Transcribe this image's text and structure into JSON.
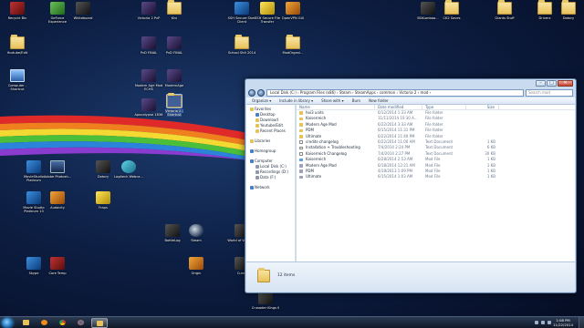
{
  "colors": {
    "selection": "#3399ff",
    "window_frame": "#c9dbef",
    "folder": "#e7c25a"
  },
  "desktop": {
    "icons": [
      {
        "id": "d1",
        "label": "Recycle Bin",
        "icon": "recycle-bin-icon"
      },
      {
        "id": "d2",
        "label": "GeForce Experience",
        "icon": "nvidia-icon"
      },
      {
        "id": "d3",
        "label": "Whiteboard",
        "icon": "app-icon"
      },
      {
        "id": "d4",
        "label": "Victoria 2 PvP",
        "icon": "victoria-2-icon"
      },
      {
        "id": "d5",
        "label": "Kivi",
        "icon": "folder-icon"
      },
      {
        "id": "d6",
        "label": "SSH Secure Shell Client",
        "icon": "ssh-icon"
      },
      {
        "id": "d7",
        "label": "SSH Secure File Transfer",
        "icon": "ssh-icon"
      },
      {
        "id": "d8",
        "label": "OpenVPN GUI",
        "icon": "openvpn-icon"
      },
      {
        "id": "d9",
        "label": "BGKumbaa...",
        "icon": "shortcut-icon"
      },
      {
        "id": "d10",
        "label": "CK2 Saves",
        "icon": "folder-icon"
      },
      {
        "id": "d11",
        "label": "Giants Stuff",
        "icon": "folder-icon"
      },
      {
        "id": "d12",
        "label": "Drivers",
        "icon": "folder-icon"
      },
      {
        "id": "d13",
        "label": "Dotory",
        "icon": "folder-icon"
      },
      {
        "id": "d14",
        "label": "Youtube/Edit",
        "icon": "folder-icon"
      },
      {
        "id": "d15",
        "label": "PvD FINAL",
        "icon": "victoria-2-icon"
      },
      {
        "id": "d16",
        "label": "PvD FINAL",
        "icon": "victoria-2-icon"
      },
      {
        "id": "d17",
        "label": "School Shit 2014",
        "icon": "folder-icon"
      },
      {
        "id": "d18",
        "label": "ModOrgani...",
        "icon": "folder-icon"
      },
      {
        "id": "d19",
        "label": "Computer - Shortcut",
        "icon": "computer-icon"
      },
      {
        "id": "d20",
        "label": "Modern Age Mod ECHS",
        "icon": "victoria-2-icon"
      },
      {
        "id": "d21",
        "label": "ModernAge",
        "icon": "victoria-2-icon"
      },
      {
        "id": "d22",
        "label": "Apocalypse 1836",
        "icon": "victoria-2-icon"
      },
      {
        "id": "d23",
        "label": "Victoria 2 - Shortcut",
        "icon": "folder-icon"
      },
      {
        "id": "d24",
        "label": "MovieStudio Platinum",
        "icon": "movie-studio-icon"
      },
      {
        "id": "d25",
        "label": "Adobe Photosh...",
        "icon": "photoshop-icon"
      },
      {
        "id": "d26",
        "label": "Dotory",
        "icon": "app-icon"
      },
      {
        "id": "d27",
        "label": "Logitech Webca...",
        "icon": "webcam-icon"
      },
      {
        "id": "d28",
        "label": "Movie Studio Platinum 13",
        "icon": "movie-studio-icon"
      },
      {
        "id": "d29",
        "label": "Audacity",
        "icon": "audacity-icon"
      },
      {
        "id": "d30",
        "label": "Fraps",
        "icon": "fraps-icon"
      },
      {
        "id": "d31",
        "label": "BattleLog",
        "icon": "battlelog-icon"
      },
      {
        "id": "d32",
        "label": "Steam",
        "icon": "steam-icon"
      },
      {
        "id": "d33",
        "label": "World of Warcraft",
        "icon": "wow-icon"
      },
      {
        "id": "d34",
        "label": "Skype",
        "icon": "skype-icon"
      },
      {
        "id": "d35",
        "label": "Core Temp",
        "icon": "core-temp-icon"
      },
      {
        "id": "d36",
        "label": "Origin",
        "icon": "origin-icon"
      },
      {
        "id": "d37",
        "label": "Curse",
        "icon": "curse-icon"
      },
      {
        "id": "d38",
        "label": "Crusader Kings II",
        "icon": "ck2-icon"
      }
    ]
  },
  "explorer": {
    "address": "Local Disk (C:)  ›  Program Files (x86)  ›  Steam  ›  SteamApps  ›  common  ›  Victoria 2  ›  mod  ›",
    "search_placeholder": "Search mod",
    "toolbar": {
      "organize": "Organize ▾",
      "include": "Include in library ▾",
      "share": "Share with ▾",
      "burn": "Burn",
      "new_folder": "New folder"
    },
    "nav": {
      "favorites": "Favorites",
      "desktop": "Desktop",
      "downloads": "Download",
      "youtube": "Youtube/Edit",
      "recent": "Recent Places",
      "libraries": "Libraries",
      "homegroup": "Homegroup",
      "computer": "Computer",
      "local_disk": "Local Disk (C:)",
      "recordings": "Recordings (D:)",
      "data": "Data (F:)",
      "network": "Network"
    },
    "columns": {
      "name": "Name",
      "date": "Date modified",
      "type": "Type",
      "size": "Size"
    },
    "files": [
      {
        "name": "hoi3 units",
        "date": "6/12/2014 1:33 AM",
        "type": "File folder",
        "size": "",
        "icon": "folder"
      },
      {
        "name": "Kaiserreich",
        "date": "11/11/2014 10:30 A...",
        "type": "File folder",
        "size": "",
        "icon": "folder"
      },
      {
        "name": "Modern Age Mod",
        "date": "6/22/2014 3:33 AM",
        "type": "File folder",
        "size": "",
        "icon": "folder"
      },
      {
        "name": "PDM",
        "date": "6/15/2014 11:31 PM",
        "type": "File folder",
        "size": "",
        "icon": "folder"
      },
      {
        "name": "Ultimate",
        "date": "6/22/2014 11:40 PM",
        "type": "File folder",
        "size": "",
        "icon": "folder"
      },
      {
        "name": "credits-changelog",
        "date": "6/22/2014 11:00 AM",
        "type": "Text Document",
        "size": "1 KB",
        "icon": "text"
      },
      {
        "name": "Installation + Troubleshooting",
        "date": "7/4/2014 2:24 PM",
        "type": "Text Document",
        "size": "6 KB",
        "icon": "text"
      },
      {
        "name": "Kaiserreich Changelog",
        "date": "7/4/2014 2:27 PM",
        "type": "Text Document",
        "size": "30 KB",
        "icon": "text"
      },
      {
        "name": "Kaiserreich",
        "date": "6/28/2014 2:53 AM",
        "type": "Mod File",
        "size": "1 KB",
        "icon": "shortcut"
      },
      {
        "name": "Modern Age Mod",
        "date": "6/18/2014 12:21 AM",
        "type": "Mod File",
        "size": "1 KB",
        "icon": "clip"
      },
      {
        "name": "PDM",
        "date": "4/18/2013 1:09 PM",
        "type": "Mod File",
        "size": "1 KB",
        "icon": "clip"
      },
      {
        "name": "Ultimate",
        "date": "6/15/2014 1:03 AM",
        "type": "Mod File",
        "size": "1 KB",
        "icon": "clip"
      }
    ],
    "status": "12 items"
  },
  "taskbar": {
    "time": "1:08 PM",
    "date": "11/22/2014",
    "buttons": [
      {
        "id": "t1",
        "icon": "explorer-icon"
      },
      {
        "id": "t2",
        "icon": "media-player-icon"
      },
      {
        "id": "t3",
        "icon": "chrome-icon"
      },
      {
        "id": "t4",
        "icon": "firefox-icon"
      },
      {
        "id": "t5",
        "icon": "folder-icon"
      }
    ]
  }
}
